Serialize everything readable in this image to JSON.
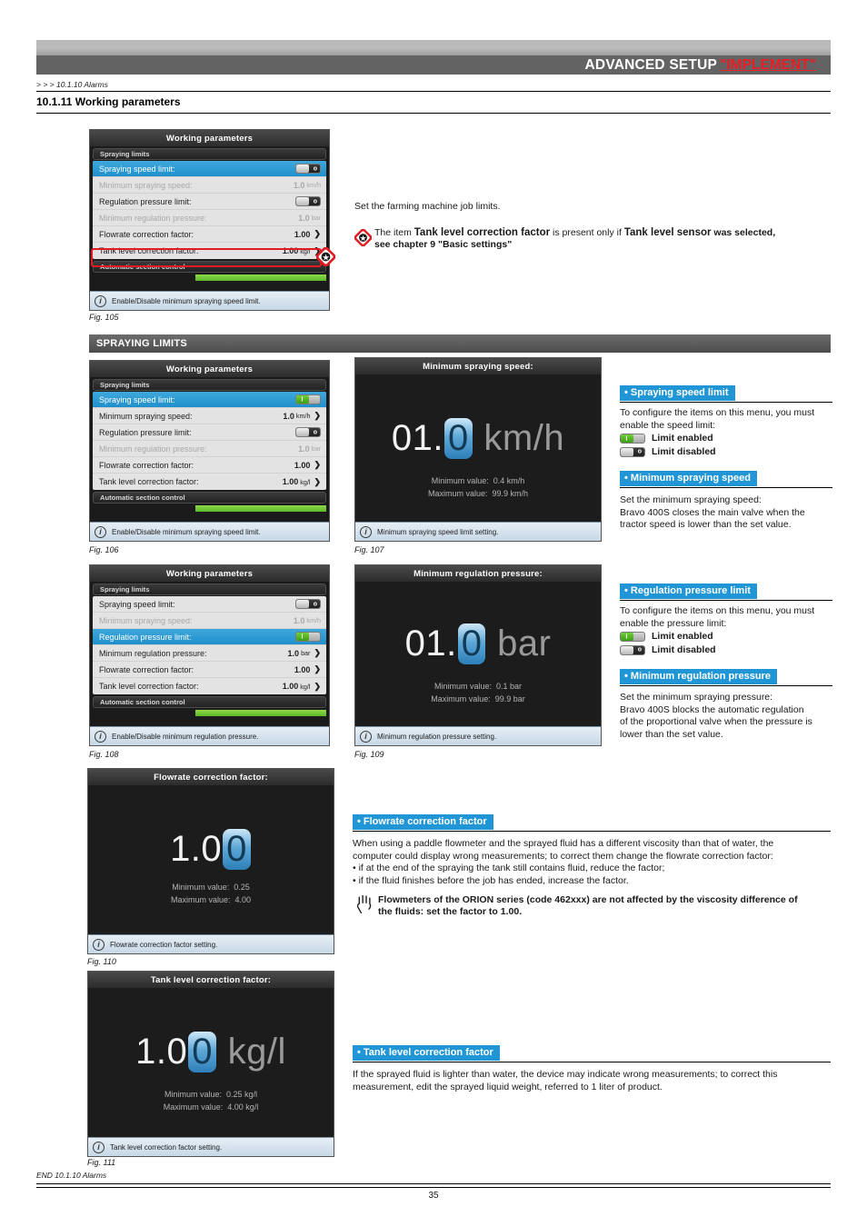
{
  "header": {
    "title": "ADVANCED SETUP",
    "highlight": "\"IMPLEMENT\""
  },
  "breadcrumb": "> > > 10.1.10 Alarms",
  "section_title": "10.1.11 Working parameters",
  "intro": {
    "text": "Set the farming machine job limits.",
    "note_icon": "star-diamond-icon",
    "note_parts": {
      "p1": "The item ",
      "b1": "Tank level correction factor",
      "p2": " is present only if ",
      "b2": "Tank level sensor",
      "p3": " was selected,",
      "p4": "see chapter 9 \"Basic settings\""
    }
  },
  "fig105": {
    "title": "Working parameters",
    "group": "Spraying limits",
    "rows": [
      {
        "label": "Spraying speed limit:",
        "kind": "toggle",
        "state": "off",
        "dim": false,
        "selected": true
      },
      {
        "label": "Minimum spraying speed:",
        "kind": "value",
        "value": "1.0",
        "unit": "km/h",
        "arrow": "",
        "dim": true,
        "selected": false
      },
      {
        "label": "Regulation pressure limit:",
        "kind": "toggle",
        "state": "off",
        "dim": false,
        "selected": false
      },
      {
        "label": "Minimum regulation pressure:",
        "kind": "value",
        "value": "1.0",
        "unit": "bar",
        "arrow": "",
        "dim": true,
        "selected": false
      },
      {
        "label": "Flowrate correction factor:",
        "kind": "value",
        "value": "1.00",
        "unit": "",
        "arrow": "❯",
        "dim": false,
        "selected": false
      },
      {
        "label": "Tank level correction factor:",
        "kind": "value",
        "value": "1.00",
        "unit": "kg/l",
        "arrow": "❯",
        "dim": false,
        "selected": false
      }
    ],
    "footer_group": "Automatic section control",
    "info": "Enable/Disable minimum spraying speed limit.",
    "caption": "Fig. 105"
  },
  "banner": "SPRAYING LIMITS",
  "fig106": {
    "title": "Working parameters",
    "group": "Spraying limits",
    "rows": [
      {
        "label": "Spraying speed limit:",
        "kind": "toggle",
        "state": "on",
        "dim": false,
        "selected": true
      },
      {
        "label": "Minimum spraying speed:",
        "kind": "value",
        "value": "1.0",
        "unit": "km/h",
        "arrow": "❯",
        "dim": false,
        "selected": false
      },
      {
        "label": "Regulation pressure limit:",
        "kind": "toggle",
        "state": "off",
        "dim": false,
        "selected": false
      },
      {
        "label": "Minimum regulation pressure:",
        "kind": "value",
        "value": "1.0",
        "unit": "bar",
        "arrow": "",
        "dim": true,
        "selected": false
      },
      {
        "label": "Flowrate correction factor:",
        "kind": "value",
        "value": "1.00",
        "unit": "",
        "arrow": "❯",
        "dim": false,
        "selected": false
      },
      {
        "label": "Tank level correction factor:",
        "kind": "value",
        "value": "1.00",
        "unit": "kg/l",
        "arrow": "❯",
        "dim": false,
        "selected": false
      }
    ],
    "footer_group": "Automatic section control",
    "info": "Enable/Disable minimum spraying speed limit.",
    "caption": "Fig. 106"
  },
  "fig107": {
    "title": "Minimum spraying speed:",
    "value_prefix": "01.",
    "value_cursor": "0",
    "value_suffix": "km/h",
    "minimum_label": "Minimum value:",
    "minimum_value": "0.4 km/h",
    "maximum_label": "Maximum value:",
    "maximum_value": "99.9 km/h",
    "info": "Minimum spraying speed limit setting.",
    "caption": "Fig. 107"
  },
  "fig108": {
    "title": "Working parameters",
    "group": "Spraying limits",
    "rows": [
      {
        "label": "Spraying speed limit:",
        "kind": "toggle",
        "state": "off",
        "dim": false,
        "selected": false
      },
      {
        "label": "Minimum spraying speed:",
        "kind": "value",
        "value": "1.0",
        "unit": "km/h",
        "arrow": "",
        "dim": true,
        "selected": false
      },
      {
        "label": "Regulation pressure limit:",
        "kind": "toggle",
        "state": "on",
        "dim": false,
        "selected": true
      },
      {
        "label": "Minimum regulation pressure:",
        "kind": "value",
        "value": "1.0",
        "unit": "bar",
        "arrow": "❯",
        "dim": false,
        "selected": false
      },
      {
        "label": "Flowrate correction factor:",
        "kind": "value",
        "value": "1.00",
        "unit": "",
        "arrow": "❯",
        "dim": false,
        "selected": false
      },
      {
        "label": "Tank level correction factor:",
        "kind": "value",
        "value": "1.00",
        "unit": "kg/l",
        "arrow": "❯",
        "dim": false,
        "selected": false
      }
    ],
    "footer_group": "Automatic section control",
    "info": "Enable/Disable minimum regulation pressure.",
    "caption": "Fig. 108"
  },
  "fig109": {
    "title": "Minimum regulation pressure:",
    "value_prefix": "01.",
    "value_cursor": "0",
    "value_suffix": "bar",
    "minimum_label": "Minimum value:",
    "minimum_value": "0.1 bar",
    "maximum_label": "Maximum value:",
    "maximum_value": "99.9 bar",
    "info": "Minimum regulation pressure setting.",
    "caption": "Fig. 109"
  },
  "fig110": {
    "title": "Flowrate correction factor:",
    "value_prefix": "1.0",
    "value_cursor": "0",
    "value_suffix": "",
    "minimum_label": "Minimum value:",
    "minimum_value": "0.25",
    "maximum_label": "Maximum value:",
    "maximum_value": "4.00",
    "info": "Flowrate correction factor setting.",
    "caption": "Fig. 110"
  },
  "fig111": {
    "title": "Tank level correction factor:",
    "value_prefix": "1.0",
    "value_cursor": "0",
    "value_suffix": "kg/l",
    "minimum_label": "Minimum value:",
    "minimum_value": "0.25 kg/l",
    "maximum_label": "Maximum value:",
    "maximum_value": "4.00 kg/l",
    "info": "Tank level correction factor setting.",
    "caption": "Fig. 111"
  },
  "annotations": {
    "spraying_speed_limit": {
      "tag": "• Spraying speed limit",
      "line1": "To configure the items on this menu, you must",
      "line2": "enable the speed limit:",
      "enabled_label": "Limit enabled",
      "disabled_label": "Limit disabled"
    },
    "minimum_spraying_speed": {
      "tag": "• Minimum spraying speed",
      "line1": "Set the minimum spraying speed:",
      "line2": "Bravo 400S closes the main valve when the",
      "line3": "tractor speed is lower than the set value."
    },
    "regulation_pressure_limit": {
      "tag": "• Regulation pressure limit",
      "line1": "To configure the items on this menu, you must",
      "line2": "enable the pressure limit:",
      "enabled_label": "Limit enabled",
      "disabled_label": "Limit disabled"
    },
    "minimum_regulation_pressure": {
      "tag": "• Minimum regulation pressure",
      "line1": "Set the minimum spraying pressure:",
      "line2": "Bravo 400S blocks the automatic regulation",
      "line3": "of the proportional valve when the pressure is",
      "line4": "lower than the set value."
    },
    "flowrate_correction_factor": {
      "tag": "• Flowrate correction factor",
      "line1": "When using a paddle flowmeter and the sprayed fluid has a different viscosity than that of water, the",
      "line2": "computer could display wrong measurements; to correct them change the flowrate correction factor:",
      "line3": "• if at the end of the spraying the tank still contains fluid, reduce the factor;",
      "line4": "• if the fluid finishes before the job has ended, increase the factor.",
      "warn_icon": "hand-icon",
      "warn1": "Flowmeters of the ORION series (code 462xxx) are not affected by the viscosity difference of",
      "warn2": "the fluids: set the factor to 1.00."
    },
    "tank_level_correction_factor": {
      "tag": "• Tank level correction factor",
      "line1": "If the sprayed fluid is lighter than water, the device may indicate wrong measurements; to correct this",
      "line2": "measurement, edit the sprayed liquid weight, referred to 1 liter of product."
    }
  },
  "footer": {
    "end_note": "END 10.1.10 Alarms",
    "page_number": "35"
  },
  "colors": {
    "accent_blue": "#2196d6",
    "red": "#e01b22",
    "toggle_green": "#5cb82a",
    "selected_row": "#2a93cf"
  }
}
